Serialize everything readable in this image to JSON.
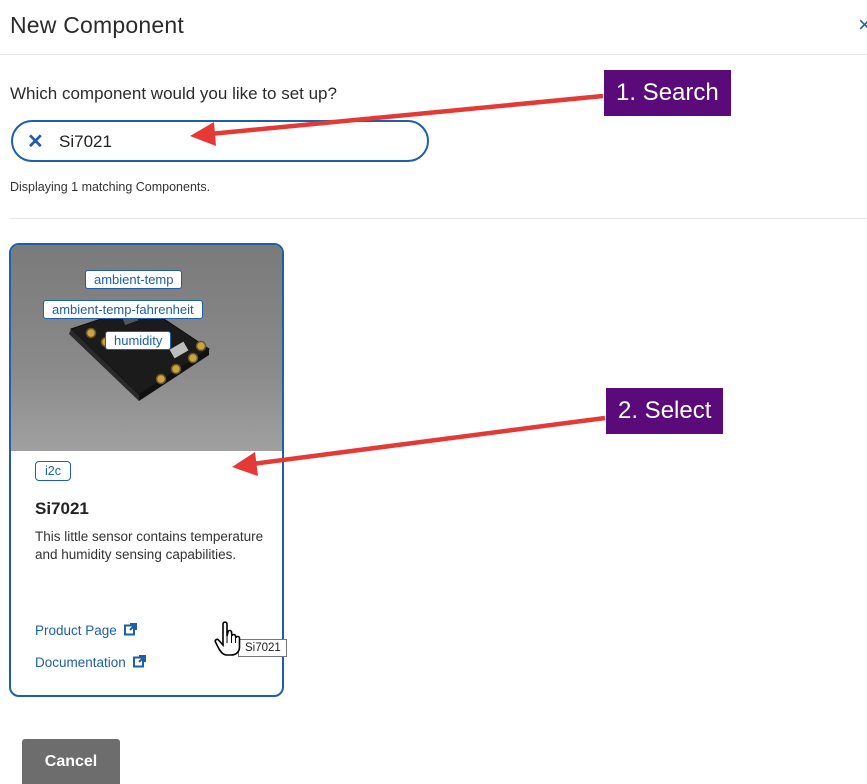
{
  "dialog": {
    "title": "New Component",
    "close_label": "×"
  },
  "search": {
    "question": "Which component would you like to set up?",
    "value": "Si7021",
    "clear_label": "✕",
    "result_text": "Displaying 1 matching Components."
  },
  "card": {
    "image_tags": [
      "ambient-temp",
      "ambient-temp-fahrenheit",
      "humidity"
    ],
    "chip": "i2c",
    "title": "Si7021",
    "description": "This little sensor contains temperature and humidity sensing capabilities.",
    "product_link": "Product Page",
    "docs_link": "Documentation",
    "tooltip": "Si7021"
  },
  "footer": {
    "cancel_label": "Cancel"
  },
  "annotations": {
    "step1": "1. Search",
    "step2": "2. Select",
    "callout_color": "#5b0a7a",
    "arrow_color": "#e53935"
  },
  "colors": {
    "accent": "#1d5fa8",
    "cancel_bg": "#6d6d6d"
  }
}
